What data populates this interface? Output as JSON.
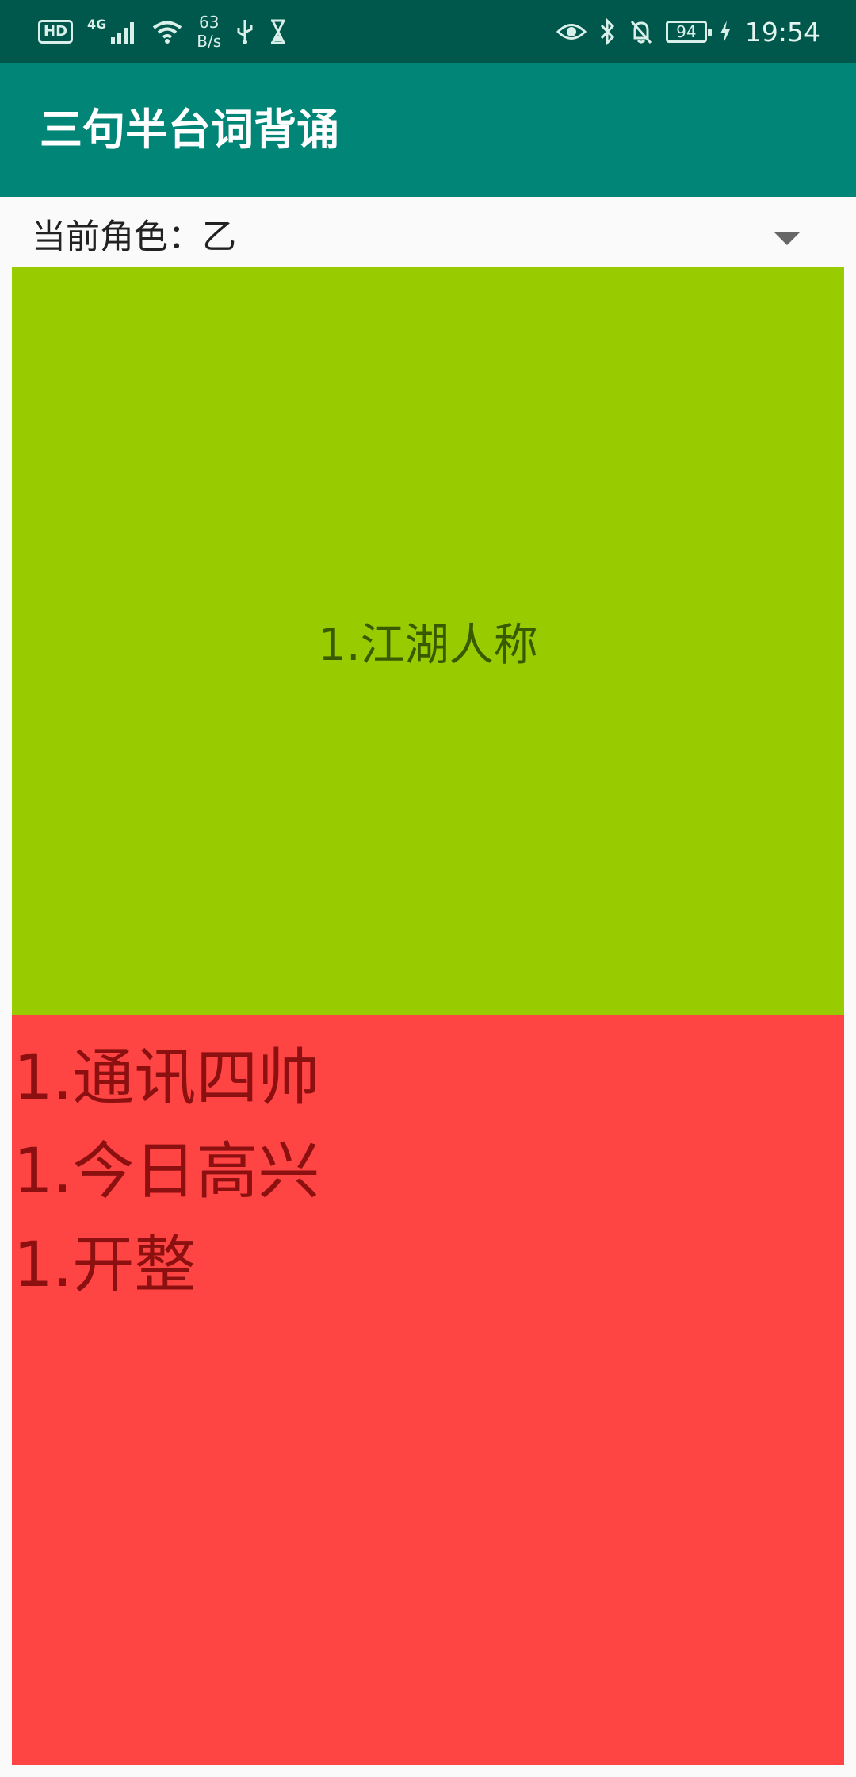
{
  "status_bar": {
    "hd": "HD",
    "network_type": "4G",
    "speed_value": "63",
    "speed_unit": "B/s",
    "battery": "94",
    "time": "19:54",
    "icons": [
      "signal-icon",
      "wifi-icon",
      "usb-icon",
      "hourglass-icon",
      "eye-icon",
      "bluetooth-icon",
      "bell-off-icon",
      "charging-icon"
    ]
  },
  "app_bar": {
    "title": "三句半台词背诵"
  },
  "role_selector": {
    "label": "当前角色：乙"
  },
  "green_panel": {
    "text": "1.江湖人称",
    "color": "#99cc00"
  },
  "red_panel": {
    "color": "#ff4444",
    "lines": [
      "1.通讯四帅",
      "1.今日高兴",
      "1.开整"
    ]
  }
}
